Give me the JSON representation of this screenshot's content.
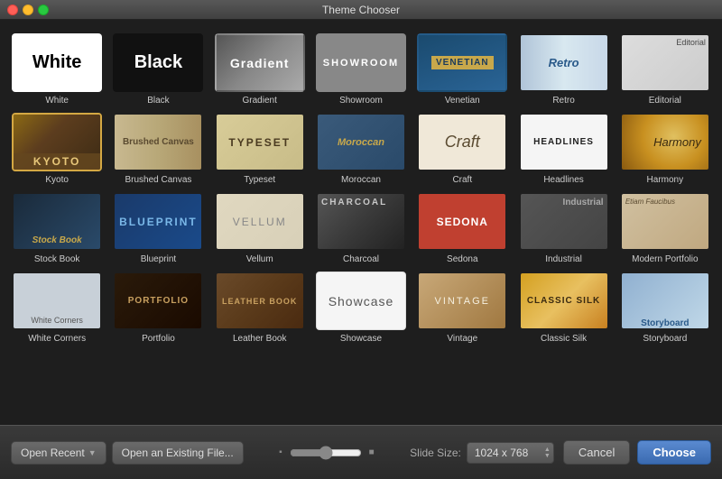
{
  "window": {
    "title": "Theme Chooser"
  },
  "themes": [
    {
      "id": "white",
      "label": "White",
      "selected": false
    },
    {
      "id": "black",
      "label": "Black",
      "selected": false
    },
    {
      "id": "gradient",
      "label": "Gradient",
      "selected": false
    },
    {
      "id": "showroom",
      "label": "Showroom",
      "selected": false
    },
    {
      "id": "venetian",
      "label": "Venetian",
      "selected": false
    },
    {
      "id": "retro",
      "label": "Retro",
      "selected": false
    },
    {
      "id": "editorial",
      "label": "Editorial",
      "selected": false
    },
    {
      "id": "kyoto",
      "label": "Kyoto",
      "selected": false
    },
    {
      "id": "brushed-canvas",
      "label": "Brushed Canvas",
      "selected": false
    },
    {
      "id": "typeset",
      "label": "Typeset",
      "selected": false
    },
    {
      "id": "moroccan",
      "label": "Moroccan",
      "selected": false
    },
    {
      "id": "craft",
      "label": "Craft",
      "selected": false
    },
    {
      "id": "headlines",
      "label": "Headlines",
      "selected": false
    },
    {
      "id": "harmony",
      "label": "Harmony",
      "selected": false
    },
    {
      "id": "stock-book",
      "label": "Stock Book",
      "selected": false
    },
    {
      "id": "blueprint",
      "label": "Blueprint",
      "selected": false
    },
    {
      "id": "vellum",
      "label": "Vellum",
      "selected": false
    },
    {
      "id": "charcoal",
      "label": "Charcoal",
      "selected": false
    },
    {
      "id": "sedona",
      "label": "Sedona",
      "selected": false
    },
    {
      "id": "industrial",
      "label": "Industrial",
      "selected": false
    },
    {
      "id": "modern-portfolio",
      "label": "Modern Portfolio",
      "selected": false
    },
    {
      "id": "white-corners",
      "label": "White Corners",
      "selected": false
    },
    {
      "id": "portfolio",
      "label": "Portfolio",
      "selected": false
    },
    {
      "id": "leather-book",
      "label": "Leather Book",
      "selected": false
    },
    {
      "id": "showcase",
      "label": "Showcase",
      "selected": false
    },
    {
      "id": "vintage",
      "label": "Vintage",
      "selected": false
    },
    {
      "id": "classic-silk",
      "label": "Classic Silk",
      "selected": false
    },
    {
      "id": "storyboard",
      "label": "Storyboard",
      "selected": false
    }
  ],
  "footer": {
    "open_recent_label": "Open Recent",
    "open_existing_label": "Open an Existing File...",
    "slide_size_label": "Slide Size:",
    "slide_size_value": "1024 x 768",
    "cancel_label": "Cancel",
    "choose_label": "Choose"
  }
}
